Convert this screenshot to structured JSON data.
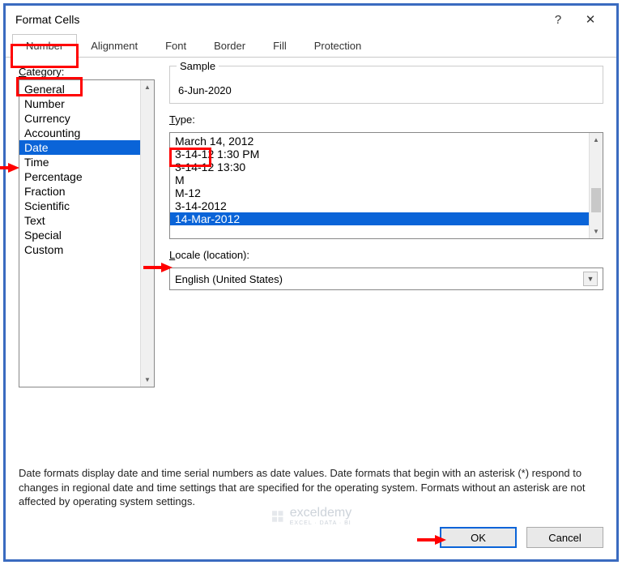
{
  "titlebar": {
    "title": "Format Cells"
  },
  "tabs": [
    "Number",
    "Alignment",
    "Font",
    "Border",
    "Fill",
    "Protection"
  ],
  "active_tab": 0,
  "category": {
    "label_pre": "C",
    "label_rest": "ategory:",
    "items": [
      "General",
      "Number",
      "Currency",
      "Accounting",
      "Date",
      "Time",
      "Percentage",
      "Fraction",
      "Scientific",
      "Text",
      "Special",
      "Custom"
    ],
    "selected": 4
  },
  "sample": {
    "label": "Sample",
    "value": "6-Jun-2020"
  },
  "type": {
    "label_pre": "T",
    "label_rest": "ype:",
    "items": [
      "March 14, 2012",
      "3-14-12 1:30 PM",
      "3-14-12 13:30",
      "M",
      "M-12",
      "3-14-2012",
      "14-Mar-2012"
    ],
    "selected": 6
  },
  "locale": {
    "label_pre": "L",
    "label_rest": "ocale (location):",
    "value": "English (United States)"
  },
  "description": "Date formats display date and time serial numbers as date values.  Date formats that begin with an asterisk (*) respond to changes in regional date and time settings that are specified for the operating system.  Formats without an asterisk are not affected by operating system settings.",
  "buttons": {
    "ok": "OK",
    "cancel": "Cancel"
  },
  "watermark": {
    "main": "exceldemy",
    "sub": "EXCEL · DATA · BI"
  }
}
